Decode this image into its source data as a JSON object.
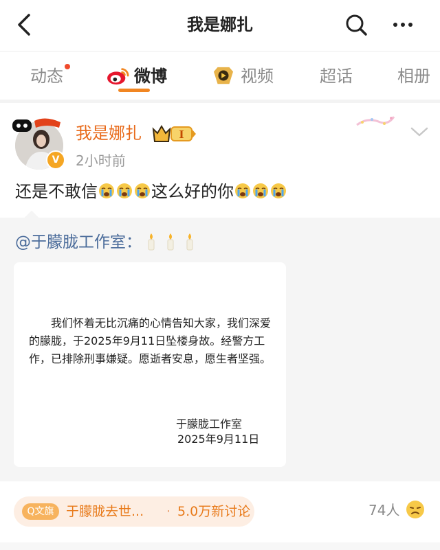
{
  "header": {
    "title": "我是娜扎",
    "back_icon": "back-chevron-icon",
    "search_icon": "search-icon",
    "more_icon": "more-icon"
  },
  "tabs": [
    {
      "label": "动态",
      "has_dot": true
    },
    {
      "label": "微博",
      "active": true,
      "icon": "weibo-logo-icon"
    },
    {
      "label": "视频",
      "icon": "video-icon"
    },
    {
      "label": "超话"
    },
    {
      "label": "相册"
    }
  ],
  "post": {
    "author": "我是娜扎",
    "vip_level": "I",
    "time": "2小时前",
    "verified_badge": "V",
    "text_parts": [
      "还是不敢信",
      "这么好的你"
    ],
    "emoji": "crying-emoji"
  },
  "repost": {
    "author": "@于朦胧工作室：",
    "candle_icon": "candle-icon",
    "statement": "我们怀着无比沉痛的心情告知大家，我们深爱的朦胧，于2025年9月11日坠楼身故。经警方工作，已排除刑事嫌疑。愿逝者安息，愿生者坚强。",
    "signature_name": "于朦胧工作室",
    "signature_date": "2025年9月11日"
  },
  "topic": {
    "tag": "Q文旗",
    "name": "于朦胧去世...",
    "separator": "·",
    "count": "5.0万新讨论"
  },
  "viewers": {
    "count": "74人",
    "icon": "sad-face-icon"
  },
  "colors": {
    "accent": "#f18622",
    "username": "#e86a1a",
    "link": "#4a6b9a",
    "dot": "#f04a2c"
  }
}
